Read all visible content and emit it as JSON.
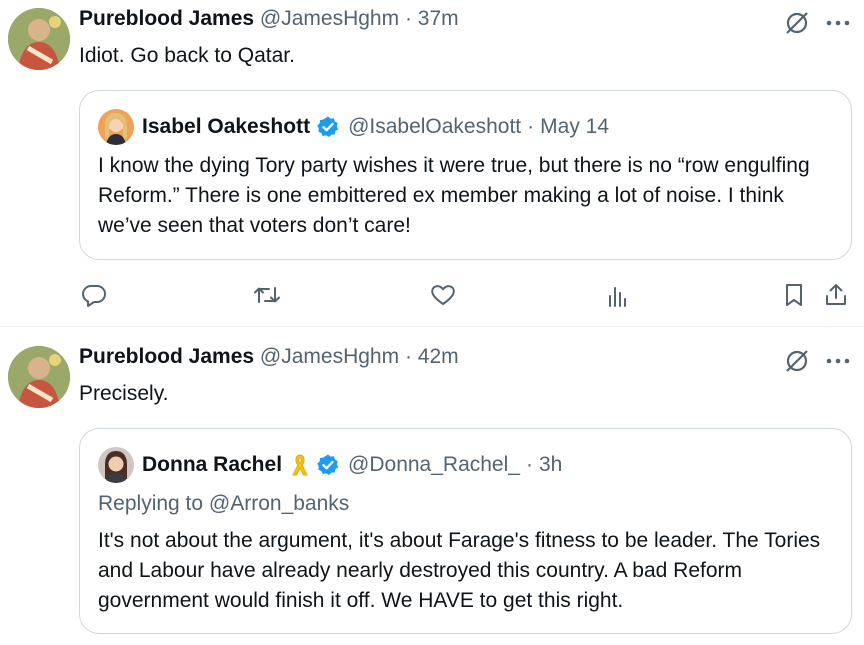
{
  "tweets": [
    {
      "author": {
        "name": "Pureblood James",
        "handle": "@JamesHghm",
        "time": "37m"
      },
      "text": "Idiot. Go back to Qatar.",
      "quote": {
        "name": "Isabel Oakeshott",
        "verified": true,
        "handle": "@IsabelOakeshott",
        "time": "May 14",
        "text": "I know the dying Tory party wishes it were true, but there is no “row engulfing Reform.” There is one embittered ex member making a lot of noise. I think we’ve seen that voters don’t care!"
      },
      "actions": [
        "reply-icon",
        "retweet-icon",
        "like-icon",
        "views-icon",
        "bookmark-icon",
        "share-icon"
      ]
    },
    {
      "author": {
        "name": "Pureblood James",
        "handle": "@JamesHghm",
        "time": "42m"
      },
      "text": "Precisely.",
      "quote": {
        "name": "Donna Rachel",
        "emoji": "yellow-ribbon-icon",
        "verified": true,
        "handle": "@Donna_Rachel_",
        "time": "3h",
        "replying_to": "Replying to @Arron_banks",
        "text": "It's not about the argument, it's about Farage's fitness to be leader. The Tories and Labour have already nearly destroyed this country. A bad Reform government would finish it off. We HAVE to get this right."
      }
    }
  ],
  "separator": "·",
  "colors": {
    "verified": "#1d9bf0",
    "muted": "#536471",
    "border": "#cfd9de",
    "text": "#0f1419"
  }
}
